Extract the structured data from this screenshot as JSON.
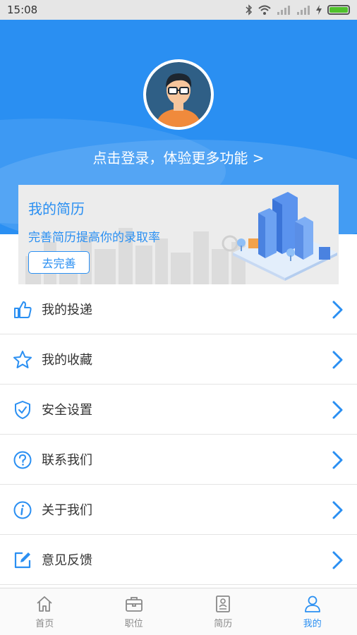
{
  "status_bar": {
    "time": "15:08"
  },
  "header": {
    "login_prompt": "点击登录，体验更多功能 >"
  },
  "resume_card": {
    "title": "我的简历",
    "subtitle": "完善简历提高你的录取率",
    "button_label": "去完善"
  },
  "menu": {
    "items": [
      {
        "label": "我的投递",
        "icon": "thumbs-up-icon"
      },
      {
        "label": "我的收藏",
        "icon": "star-icon"
      },
      {
        "label": "安全设置",
        "icon": "shield-check-icon"
      },
      {
        "label": "联系我们",
        "icon": "question-circle-icon"
      },
      {
        "label": "关于我们",
        "icon": "info-circle-icon"
      },
      {
        "label": "意见反馈",
        "icon": "edit-icon"
      }
    ]
  },
  "tabbar": {
    "tabs": [
      {
        "label": "首页",
        "icon": "home-icon",
        "active": false
      },
      {
        "label": "职位",
        "icon": "briefcase-icon",
        "active": false
      },
      {
        "label": "简历",
        "icon": "resume-icon",
        "active": false
      },
      {
        "label": "我的",
        "icon": "user-icon",
        "active": true
      }
    ]
  },
  "colors": {
    "accent": "#2a8ff2",
    "status_bar": "#e6e6e6",
    "battery": "#4fc12b"
  }
}
